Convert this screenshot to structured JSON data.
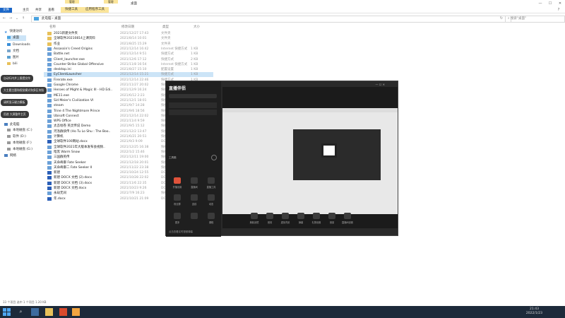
{
  "window": {
    "title": "桌面",
    "ribbon_tabs": [
      "文件",
      "主页",
      "共享",
      "查看"
    ],
    "context_tabs": [
      {
        "group": "管理",
        "tab": "快捷工具"
      },
      {
        "group": "管理",
        "tab": "应用程序工具"
      }
    ],
    "controls": [
      "—",
      "☐",
      "✕"
    ]
  },
  "address_bar": {
    "path": "此电脑 › 桌面",
    "search_placeholder": "搜索\"桌面\""
  },
  "sidebar": {
    "items": [
      "快速访问",
      "桌面",
      "Downloads",
      "文档",
      "图片",
      "bili",
      "此电脑",
      "本地磁盘 (C:)",
      "软件 (D:)",
      "本地磁盘 (F:)",
      "本地磁盘 (G:)",
      "网络"
    ]
  },
  "columns": {
    "name": "名称",
    "date": "修改日期",
    "type": "类型",
    "size": "大小"
  },
  "files": [
    {
      "name": "2021新建文件夹",
      "date": "2021/12/27 17:43",
      "type": "文件夹",
      "size": ""
    },
    {
      "name": "全球软件20210814上课资料",
      "date": "2021/8/14 10:01",
      "type": "文件夹",
      "size": ""
    },
    {
      "name": "作业",
      "date": "2021/8/25 15:29",
      "type": "文件夹",
      "size": ""
    },
    {
      "name": "Assassin's Creed Origins",
      "date": "2021/12/14 16:42",
      "type": "Internet 快捷方式",
      "size": "1 KB"
    },
    {
      "name": "Battle.net",
      "date": "2021/12/14 9:51",
      "type": "快捷方式",
      "size": "1 KB"
    },
    {
      "name": "Client_launcher.exe",
      "date": "2021/12/6 17:12",
      "type": "快捷方式",
      "size": "2 KB"
    },
    {
      "name": "Counter-Strike Global Offensive",
      "date": "2021/11/8 16:54",
      "type": "Internet 快捷方式",
      "size": "1 KB"
    },
    {
      "name": "desktop.ini",
      "date": "2021/8/27 15:10",
      "type": "配置设置",
      "size": "1 KB"
    },
    {
      "name": "EyClientLauncher",
      "date": "2021/12/14 15:21",
      "type": "快捷方式",
      "size": "1 KB"
    },
    {
      "name": "Firerate.exe",
      "date": "2021/12/14 22:46",
      "type": "快捷方式",
      "size": "1 KB"
    },
    {
      "name": "Google Chrome",
      "date": "2021/11/27 20:02",
      "type": "快捷方式",
      "size": "1 KB"
    },
    {
      "name": "Heroes of Might & Magic III - HD Edi..",
      "date": "2021/12/9 16:24",
      "type": "快捷方式",
      "size": "1 KB"
    },
    {
      "name": "ME11.exe",
      "date": "2021/6/12 2:23",
      "type": "快捷方式",
      "size": "1 KB"
    },
    {
      "name": "Sid Meier's Civilization VI",
      "date": "2021/12/1 18:01",
      "type": "快捷方式",
      "size": "1 KB"
    },
    {
      "name": "steam",
      "date": "2021/9/7 14:28",
      "type": "快捷方式",
      "size": "1 KB"
    },
    {
      "name": "Trine 4 The Nightmare Prince",
      "date": "2021/9/6 18:56",
      "type": "快捷方式",
      "size": "1 KB"
    },
    {
      "name": "Ubisoft Connect",
      "date": "2021/12/14 22:02",
      "type": "快捷方式",
      "size": "1 KB"
    },
    {
      "name": "WPS Office",
      "date": "2021/11/4 9:59",
      "type": "快捷方式",
      "size": "1 KB"
    },
    {
      "name": "太吾绘卷 英灵传说 Demo",
      "date": "2021/9/5 15:12",
      "type": "快捷方式",
      "size": "1 KB"
    },
    {
      "name": "河洛群侠传 (Ho Tu Lo Shu : The Boo..",
      "date": "2021/12/2 13:47",
      "type": "快捷方式",
      "size": "1 KB"
    },
    {
      "name": "计算机",
      "date": "2021/6/21 20:51",
      "type": "快捷方式",
      "size": "1 KB"
    },
    {
      "name": "全球软件100网站.docx",
      "date": "2021/9/3 9:09",
      "type": "DOCX 文档",
      "size": "21 KB"
    },
    {
      "name": "全球软件2021年大版本发布会视频..",
      "date": "2021/12/25 16:38",
      "type": "快捷方式",
      "size": "1 KB"
    },
    {
      "name": "暗黑 Warm Snow",
      "date": "2022/1/2 15:46",
      "type": "快捷方式",
      "size": "1 KB"
    },
    {
      "name": "三国群英传",
      "date": "2021/12/11 19:00",
      "type": "快捷方式",
      "size": "1 KB"
    },
    {
      "name": "天命奇御 Fate Seeker",
      "date": "2021/12/18 20:01",
      "type": "快捷方式",
      "size": "1 KB"
    },
    {
      "name": "天命奇御二 Fate Seeker II",
      "date": "2021/11/22 23:38",
      "type": "快捷方式",
      "size": "1 KB"
    },
    {
      "name": "新建",
      "date": "2021/10/24 12:55",
      "type": "DOCX 文档",
      "size": "0 KB"
    },
    {
      "name": "新建 DOCX 文档 (2).docx",
      "date": "2021/10/28 22:02",
      "type": "DOCX 文档",
      "size": "12 KB"
    },
    {
      "name": "新建 DOCX 文档 (3).docx",
      "date": "2021/11/6 22:35",
      "type": "DOCX 文档",
      "size": "15 KB"
    },
    {
      "name": "新建 DOCX 文档.docx",
      "date": "2021/10/23 9:26",
      "type": "DOCX 文档",
      "size": "12 KB"
    },
    {
      "name": "永劫无间",
      "date": "2021/7/9 16:23",
      "type": "快捷方式",
      "size": "1 KB"
    },
    {
      "name": "年.docx",
      "date": "2021/10/21 21:09",
      "type": "DOCX 文档",
      "size": "13 KB"
    }
  ],
  "tooltips": [
    "自动行内并上限提交作",
    "大主题主题和视觉模式和多区块指",
    "请将显示键点模板",
    "用途 大屏整件主页"
  ],
  "status_bar": "33 个项目   选中 1 个项目  1.20 KB",
  "app": {
    "logo": "直播伴侣",
    "left_buttons": [
      "开播设置",
      "直播间",
      "直播工具",
      "粉丝群",
      "连线",
      "动态",
      "更多",
      "",
      "课程"
    ],
    "bottom_buttons": [
      "美颜滤镜",
      "音效",
      "虚拟背景",
      "弹幕",
      "礼物设置",
      "音量",
      "直播间设置"
    ],
    "status": "点击查看实时视频弹幕"
  },
  "taskbar": {
    "time": "21:43",
    "date": "2022/1/23"
  }
}
